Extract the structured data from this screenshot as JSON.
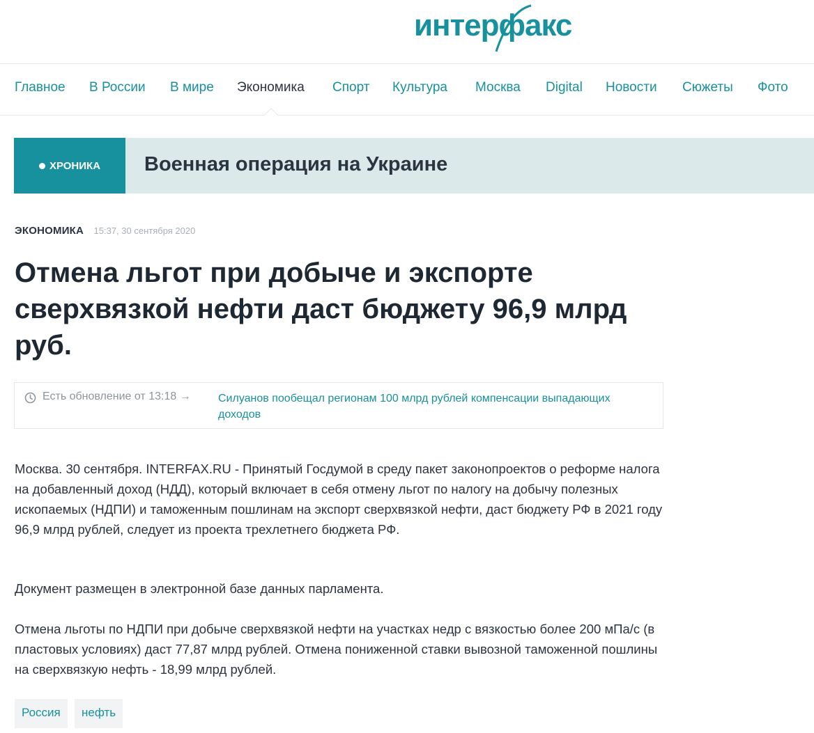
{
  "logo": {
    "text": "интерфакс",
    "icon": "interfax-logo"
  },
  "nav": {
    "items": [
      {
        "label": "Главное"
      },
      {
        "label": "В России"
      },
      {
        "label": "В мире"
      },
      {
        "label": "Экономика",
        "active": true
      },
      {
        "label": "Спорт"
      },
      {
        "label": "Культура"
      },
      {
        "label": "Москва"
      },
      {
        "label": "Digital"
      },
      {
        "label": "Новости"
      },
      {
        "label": "Сюжеты"
      },
      {
        "label": "Фото"
      }
    ]
  },
  "banner": {
    "badge": "ХРОНИКА",
    "title": "Военная операция на Украине"
  },
  "article": {
    "section": "ЭКОНОМИКА",
    "datetime": "15:37, 30 сентября 2020",
    "headline": "Отмена льгот при добыче и экспорте сверхвязкой нефти даст бюджету 96,9 млрд руб.",
    "update": {
      "icon": "clock-icon",
      "label": "Есть обновление от 13:18 →",
      "link": "Силуанов пообещал регионам 100 млрд рублей компенсации выпадающих доходов"
    },
    "paragraphs": [
      "Москва. 30 сентября. INTERFAX.RU - Принятый Госдумой в среду пакет законопроектов о реформе налога на добавленный доход (НДД), который включает в себя отмену льгот по налогу на добычу полезных ископаемых (НДПИ) и таможенным пошлинам на экспорт сверхвязкой нефти, даст бюджету РФ в 2021 году 96,9 млрд рублей, следует из проекта трехлетнего бюджета РФ.",
      "Документ размещен в электронной базе данных парламента.",
      "Отмена льготы по НДПИ при добыче сверхвязкой нефти на участках недр с вязкостью более 200 мПа/с (в пластовых условиях) даст 77,87 млрд рублей. Отмена пониженной ставки вывозной таможенной пошлины на сверхвязкую нефть - 18,99 млрд рублей."
    ],
    "tags": [
      "Россия",
      "нефть"
    ]
  },
  "colors": {
    "accent": "#17919e",
    "banner_bg": "#dbe9ea",
    "text": "#1e2833",
    "muted": "#a9b0b5"
  }
}
